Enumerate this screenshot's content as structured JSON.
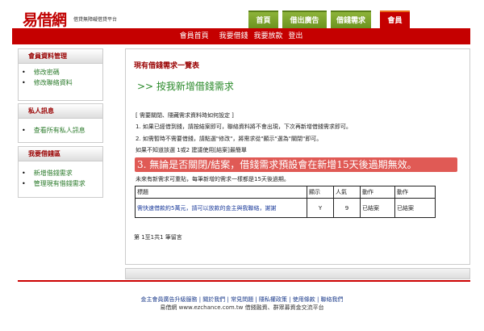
{
  "header": {
    "logo": "易借網",
    "slogan": "借貸無障礙借貸平台",
    "tabs": [
      {
        "label": "首頁"
      },
      {
        "label": "借出廣告"
      },
      {
        "label": "借錢需求"
      },
      {
        "label": "會員",
        "active": true
      }
    ],
    "nav": [
      "會員首頁",
      "我要借錢",
      "我要放款",
      "登出"
    ]
  },
  "sidebar": [
    {
      "title": "會員資料管理",
      "items": [
        "修改密碼",
        "修改聯絡資料"
      ]
    },
    {
      "title": "私人訊息",
      "items": [
        "查看所有私人訊息"
      ]
    },
    {
      "title": "我要借錢區",
      "items": [
        "新增借錢需求",
        "管理現有借錢需求"
      ]
    }
  ],
  "main": {
    "title": "現有借錢需求一覽表",
    "add_link": ">> 按我新增借錢需求",
    "instructions": [
      "[ 需要關閉、隱藏需求資料時如何設定 ]",
      "1. 如果已經借到錢，請按結案即可，聯絡資料將不會出現，下次再新增借錢需求即可。",
      "2. 如需暫時不需要借錢，請點選\"修改\"，將需求從\"顯示\"選為\"關閉\"即可。",
      "如果不知道該選 1或2 建議使用[結案]最簡單"
    ],
    "banner": "3. 無論是否關閉/結案，借錢需求預設會在新增15天後過期無效。",
    "note": "未來有新需求可重貼，每筆新增的需求一樣都是15天後過期。",
    "table": {
      "headers": [
        "標題",
        "顯示",
        "人氣",
        "動作",
        "動作"
      ],
      "rows": [
        {
          "title": "需快速借款約5萬元，請可以放款的金主與我聯絡，謝謝",
          "show": "Y",
          "views": "9",
          "action1": "已結案",
          "action2": "已結案"
        }
      ]
    },
    "pagination": "第 1至1共1 筆留言"
  },
  "footer": {
    "links": [
      "金主會員廣告升級服務",
      "關於我們",
      "常見問題",
      "隱私權政策",
      "使用條款",
      "聯絡我們"
    ],
    "tagline": "易借網 www.ezchance.com.tw 借錢融資、群眾募資金交流平台"
  }
}
